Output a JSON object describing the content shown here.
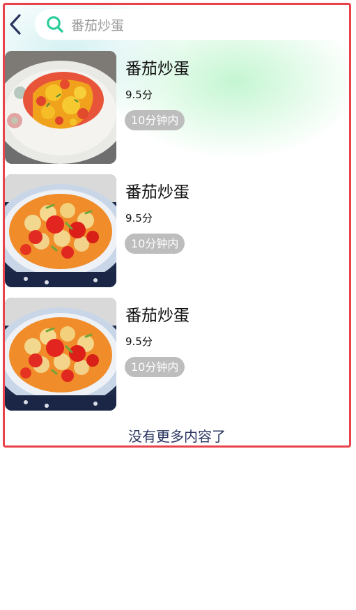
{
  "search": {
    "value": "番茄炒蛋",
    "placeholder": "番茄炒蛋"
  },
  "icons": {
    "back": "chevron-left-icon",
    "search": "search-icon"
  },
  "colors": {
    "accent": "#2ccc9b",
    "back_icon": "#2a3560",
    "tag_bg": "#bdbdbd",
    "frame_border": "#e8434a"
  },
  "results": [
    {
      "title": "番茄炒蛋",
      "rating": "9.5分",
      "time_tag": "10分钟内"
    },
    {
      "title": "番茄炒蛋",
      "rating": "9.5分",
      "time_tag": "10分钟内"
    },
    {
      "title": "番茄炒蛋",
      "rating": "9.5分",
      "time_tag": "10分钟内"
    }
  ],
  "footer": {
    "no_more": "没有更多内容了"
  }
}
